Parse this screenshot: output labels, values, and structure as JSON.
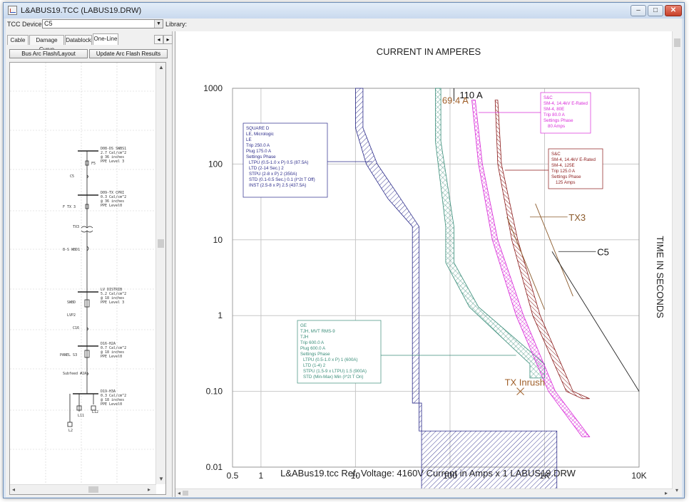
{
  "window": {
    "title": "L&ABUS19.TCC (LABUS19.DRW)",
    "min_glyph": "–",
    "max_glyph": "□",
    "close_glyph": "✕"
  },
  "toolbar": {
    "device_list_label": "TCC Device List:",
    "device_value": "C5",
    "library_label": "Library:"
  },
  "left_panel": {
    "tabs": [
      {
        "label": "Cable",
        "active": false
      },
      {
        "label": "Damage Curve",
        "active": false
      },
      {
        "label": "Datablock",
        "active": false
      },
      {
        "label": "One-Line",
        "active": true
      }
    ],
    "buttons": {
      "bus_arc_flash": "Bus Arc Flash/Layout",
      "update_arc_flash": "Update Arc Flash Results"
    },
    "oneline_labels": {
      "bus1": [
        "D08-DS SWBS1",
        "2.7 Cal/cm^2",
        "@ 36 inches",
        "PPE Level 3"
      ],
      "bus2": [
        "D09-TX CPRI",
        "0.3 Cal/cm^2",
        "@ 36 inches",
        "PPE Level0"
      ],
      "bus3": [
        "LV DISTRIB",
        "5.2 Cal/cm^2",
        "@ 18 inches",
        "PPE Level 3"
      ],
      "bus4": [
        "D16-H2A",
        "0.7 Cal/cm^2",
        "@ 18 inches",
        "PPE Level0"
      ],
      "bus5": [
        "D19-H3A",
        "0.3 Cal/cm^2",
        "@ 18 inches",
        "PPE Level0"
      ],
      "f5": "F5",
      "c5": "C5",
      "ftx3": "F TX 3",
      "tx3": "TX3",
      "swbd1": "8-S WBD1",
      "swbd": "SWBD",
      "lvp2": "LVP2",
      "c16": "C16",
      "panel_s3": "PANEL S3",
      "subfeed": "Subfeed #2A",
      "l11": "L11",
      "l12": "L12",
      "l2": "L2"
    }
  },
  "chart": {
    "top_title": "CURRENT IN AMPERES",
    "y_axis_label": "TIME IN SECONDS",
    "footer": "L&ABus19.tcc   Ref. Voltage: 4160V   Current in Amps x 1   LABUS19.DRW",
    "x_ticks": [
      "0.5",
      "1",
      "10",
      "100",
      "1K",
      "10K"
    ],
    "y_ticks": [
      "1000",
      "100",
      "10",
      "1",
      "0.10",
      "0.01"
    ],
    "labels": {
      "i110": "110 A",
      "i69": "69.4 A",
      "tx3": "TX3",
      "c5": "C5",
      "inrush": "TX Inrush"
    },
    "colors": {
      "squared": "#2c2c8a",
      "ge": "#3b8e7a",
      "sc80": "#d92bd9",
      "sc125": "#8b1a1a",
      "tx3": "#8b5a2b",
      "inrush": "#a0602a"
    }
  },
  "chart_data": [
    {
      "type": "line",
      "title": "CURRENT IN AMPERES",
      "xlabel": "",
      "ylabel": "TIME IN SECONDS",
      "x_scale": "log",
      "y_scale": "log",
      "xlim": [
        0.5,
        10000
      ],
      "ylim": [
        0.01,
        1000
      ],
      "grid": true,
      "series": [
        {
          "name": "SQUARE D",
          "datablock": [
            "SQUARE D",
            "LE, Micrologic",
            "LE",
            "Trip 250.0 A",
            "Plug 175.0 A",
            "Settings Phase",
            "LTPU (0.5-1.0 x P) 0.5 (87.5A)",
            "LTD (2-14 Sec.) 2",
            "STPU (2-8 x P) 2 (350A)",
            "STD (0.1-0.5 Sec.) 0.1 (I^2t T Off)",
            "INST (2.5-8 x P) 2.5 (437.5A)"
          ],
          "min": [
            [
              10,
              1000
            ],
            [
              10,
              300
            ],
            [
              13,
              100
            ],
            [
              22,
              35
            ],
            [
              40,
              15
            ],
            [
              40,
              0.07
            ],
            [
              50,
              0.07
            ],
            [
              50,
              0.005
            ]
          ],
          "max": [
            [
              12,
              1000
            ],
            [
              12,
              300
            ],
            [
              17,
              100
            ],
            [
              30,
              35
            ],
            [
              47,
              15
            ],
            [
              47,
              0.03
            ],
            [
              1350,
              0.03
            ],
            [
              1350,
              0.005
            ]
          ]
        },
        {
          "name": "GE",
          "datablock": [
            "GE",
            "TJH, MVT RMS-9",
            "TJH",
            "Trip 600.0 A",
            "Plug 600.0 A",
            "Settings Phase",
            "LTPU (0.5-1.0 x P) 1 (600A)",
            "LTD (1-4) 2",
            "STPU (1.5-9 x LTPU) 1.5 (900A)",
            "STD (Min-Max) Min (I^2t T On)"
          ],
          "min": [
            [
              70,
              1000
            ],
            [
              70,
              200
            ],
            [
              90,
              15
            ],
            [
              90,
              5
            ],
            [
              160,
              1.3
            ],
            [
              700,
              0.23
            ],
            [
              700,
              0.15
            ]
          ],
          "max": [
            [
              80,
              1000
            ],
            [
              80,
              200
            ],
            [
              110,
              15
            ],
            [
              110,
              5
            ],
            [
              200,
              1.3
            ],
            [
              1000,
              0.23
            ],
            [
              1000,
              0.15
            ]
          ]
        },
        {
          "name": "S&C SM-4, 14.4kV E-Rated, 80E",
          "datablock": [
            "S&C",
            "SM-4, 14.4kV E-Rated",
            "SM-4, 80E",
            "Trip 80.0 A",
            "Settings Phase",
            "80 Amps"
          ],
          "min": [
            [
              170,
              700
            ],
            [
              200,
              100
            ],
            [
              280,
              10
            ],
            [
              500,
              1
            ],
            [
              1100,
              0.1
            ],
            [
              2500,
              0.025
            ]
          ],
          "max": [
            [
              185,
              700
            ],
            [
              220,
              100
            ],
            [
              320,
              10
            ],
            [
              600,
              1
            ],
            [
              1300,
              0.1
            ],
            [
              3000,
              0.025
            ]
          ]
        },
        {
          "name": "S&C SM-4, 14.4kV E-Rated, 125E",
          "datablock": [
            "S&C",
            "SM-4, 14.4kV E-Rated",
            "SM-4, 125E",
            "Trip 125.0 A",
            "Settings Phase",
            "125 Amps"
          ],
          "min": [
            [
              300,
              700
            ],
            [
              320,
              100
            ],
            [
              450,
              10
            ],
            [
              750,
              1
            ],
            [
              1700,
              0.1
            ],
            [
              2500,
              0.08
            ]
          ],
          "max": [
            [
              320,
              700
            ],
            [
              350,
              100
            ],
            [
              520,
              10
            ],
            [
              900,
              1
            ],
            [
              2000,
              0.1
            ],
            [
              3000,
              0.08
            ]
          ]
        },
        {
          "name": "TX3",
          "points": [
            [
              400,
              20
            ],
            [
              1000,
              1.2
            ]
          ]
        },
        {
          "name": "C5",
          "points": [
            [
              1200,
              7
            ],
            [
              10000,
              0.1
            ]
          ]
        },
        {
          "name": "TX Inrush",
          "points": [
            [
              555,
              0.1
            ]
          ]
        }
      ],
      "annotations": [
        {
          "text": "110 A",
          "x": 110,
          "y": 1000
        },
        {
          "text": "69.4 A",
          "x": 69.4,
          "y": 700
        }
      ]
    }
  ]
}
